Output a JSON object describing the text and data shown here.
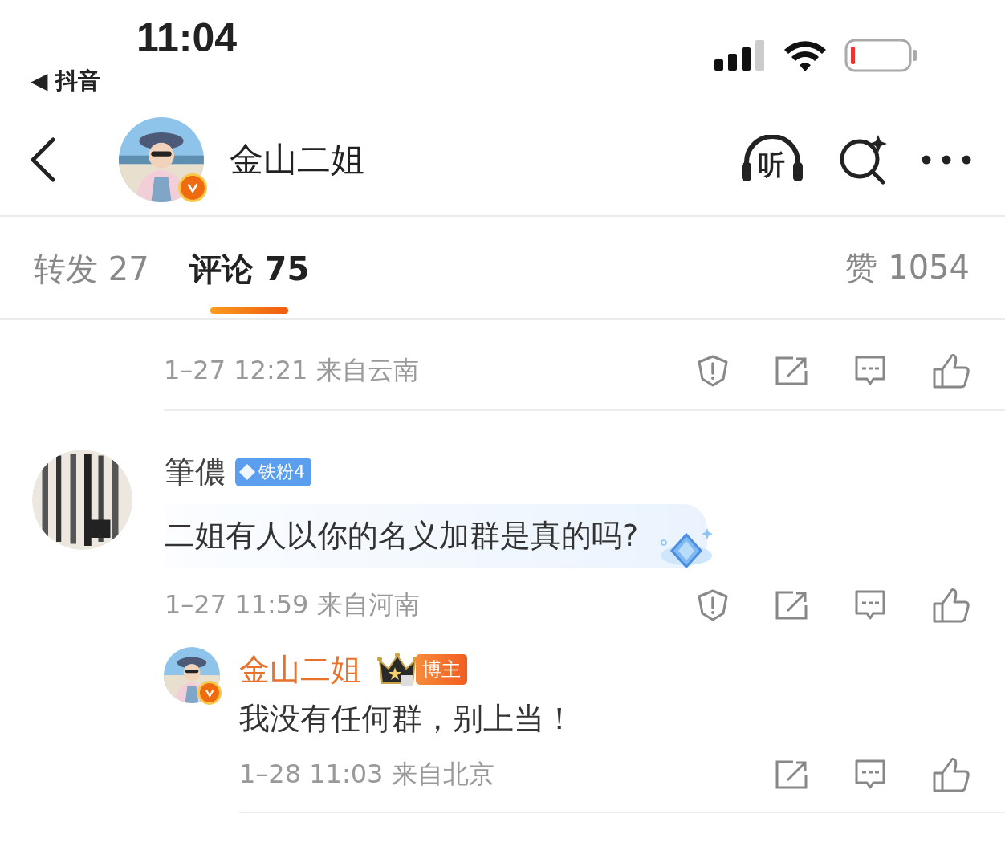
{
  "status_bar": {
    "time": "11:04",
    "back_app": "◀ 抖音"
  },
  "header": {
    "title": "金山二姐",
    "verified": true,
    "listen_label": "听"
  },
  "tabs": [
    {
      "label": "转发 27",
      "selected": false
    },
    {
      "label": "评论 75",
      "selected": true
    }
  ],
  "likes_count": "赞 1054",
  "comments": [
    {
      "kind": "partial",
      "meta": "1–27 12:21 来自云南",
      "actions": [
        {
          "kind": "report"
        },
        {
          "kind": "share"
        },
        {
          "kind": "reply"
        },
        {
          "kind": "like"
        }
      ]
    },
    {
      "kind": "comment",
      "name": "筆儂",
      "author": false,
      "badge": {
        "kind": "fan",
        "label": "铁粉4"
      },
      "text": "二姐有人以你的名义加群是真的吗?",
      "bubble": true,
      "meta": "1–27 11:59 来自河南",
      "actions": [
        {
          "kind": "report"
        },
        {
          "kind": "share"
        },
        {
          "kind": "reply"
        },
        {
          "kind": "like"
        }
      ]
    },
    {
      "kind": "reply",
      "name": "金山二姐",
      "author": true,
      "verified": true,
      "badge": {
        "kind": "blogger",
        "label": "博主"
      },
      "text": "我没有任何群，别上当！",
      "bubble": false,
      "meta": "1–28 11:03 来自北京",
      "actions": [
        {
          "kind": "share"
        },
        {
          "kind": "reply"
        },
        {
          "kind": "like"
        }
      ]
    }
  ]
}
